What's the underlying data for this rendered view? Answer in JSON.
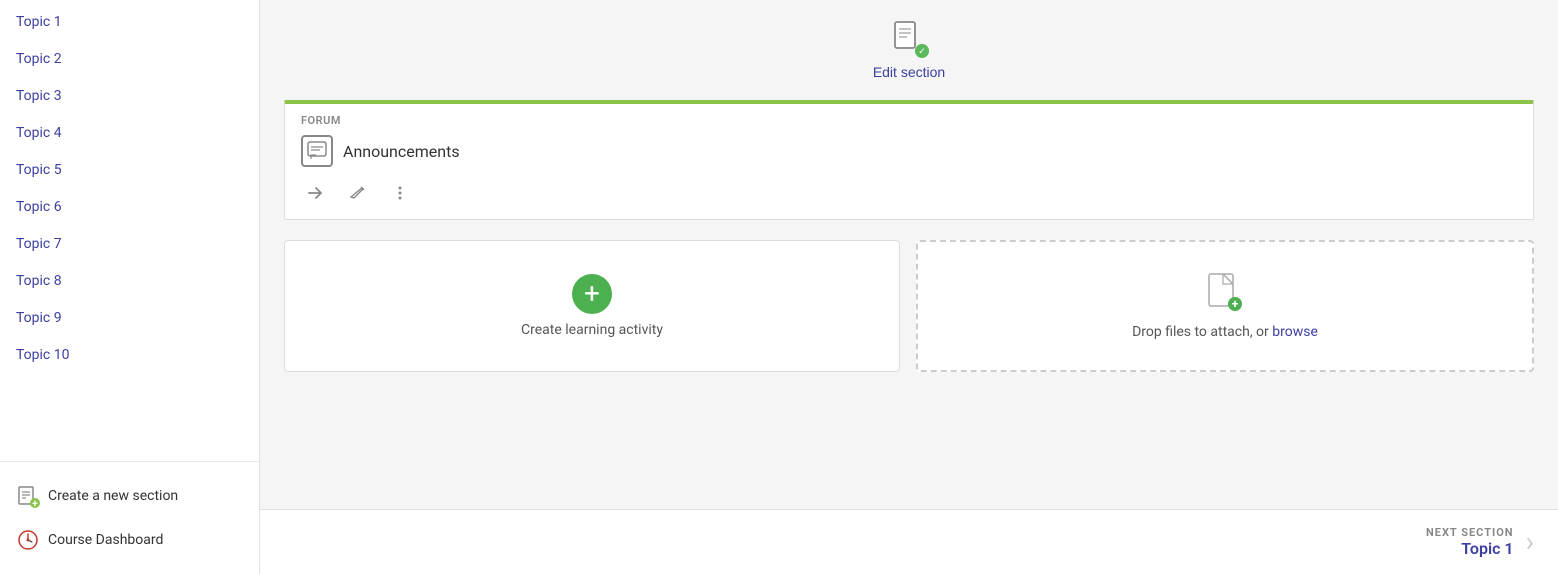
{
  "sidebar": {
    "topics": [
      {
        "label": "Topic 1"
      },
      {
        "label": "Topic 2"
      },
      {
        "label": "Topic 3"
      },
      {
        "label": "Topic 4"
      },
      {
        "label": "Topic 5"
      },
      {
        "label": "Topic 6"
      },
      {
        "label": "Topic 7"
      },
      {
        "label": "Topic 8"
      },
      {
        "label": "Topic 9"
      },
      {
        "label": "Topic 10"
      }
    ],
    "create_section_label": "Create a new section",
    "dashboard_label": "Course Dashboard"
  },
  "main": {
    "edit_section_label": "Edit section",
    "forum": {
      "badge": "FORUM",
      "title": "Announcements"
    },
    "create_activity": {
      "label": "Create learning activity"
    },
    "drop_files": {
      "label": "Drop files to attach, or",
      "browse_label": "browse"
    },
    "next_section": {
      "label": "NEXT SECTION",
      "title": "Topic 1"
    }
  }
}
